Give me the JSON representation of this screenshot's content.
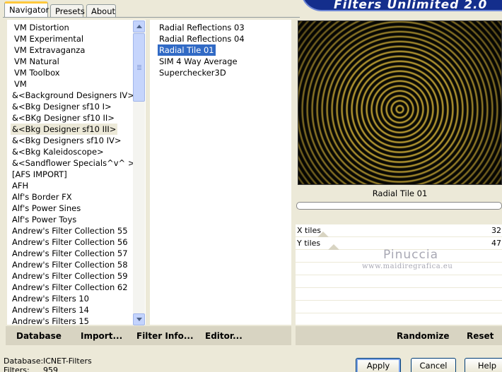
{
  "tabs": [
    {
      "label": "Navigator"
    },
    {
      "label": "Presets"
    },
    {
      "label": "About"
    }
  ],
  "banner": {
    "title": "Filters Unlimited 2.0"
  },
  "categories": [
    "VM Distortion",
    "VM Experimental",
    "VM Extravaganza",
    "VM Natural",
    "VM Toolbox",
    "VM",
    "&<Background Designers IV>",
    "&<Bkg Designer sf10 I>",
    "&<BKg Designer sf10 II>",
    "&<Bkg Designer sf10 III>",
    "&<Bkg Designers sf10 IV>",
    "&<Bkg Kaleidoscope>",
    "&<Sandflower Specials^v^ >",
    "[AFS IMPORT]",
    "AFH",
    "Alf's Border FX",
    "Alf's Power Sines",
    "Alf's Power Toys",
    "Andrew's Filter Collection 55",
    "Andrew's Filter Collection 56",
    "Andrew's Filter Collection 57",
    "Andrew's Filter Collection 58",
    "Andrew's Filter Collection 59",
    "Andrew's Filter Collection 62",
    "Andrew's Filters 10",
    "Andrew's Filters 14",
    "Andrew's Filters 15"
  ],
  "selected_category": "&<Bkg Designer sf10 III>",
  "filters": [
    "Radial Reflections 03",
    "Radial Reflections 04",
    "Radial Tile 01",
    "SIM 4 Way Average",
    "Superchecker3D"
  ],
  "selected_filter": "Radial Tile 01",
  "preview": {
    "caption": "Radial Tile 01"
  },
  "params": [
    {
      "label": "X tiles",
      "value": "32"
    },
    {
      "label": "Y tiles",
      "value": "47"
    }
  ],
  "watermark": {
    "name": "Pinuccia",
    "url": "www.maidiregrafica.eu"
  },
  "toolbar": {
    "database": "Database",
    "import": "Import...",
    "filter_info": "Filter Info...",
    "editor": "Editor...",
    "randomize": "Randomize",
    "reset": "Reset"
  },
  "status": {
    "database_label": "Database:",
    "database_value": "ICNET-Filters",
    "filters_label": "Filters:",
    "filters_value": "959"
  },
  "buttons": {
    "apply": "Apply",
    "cancel": "Cancel",
    "help": "Help"
  }
}
